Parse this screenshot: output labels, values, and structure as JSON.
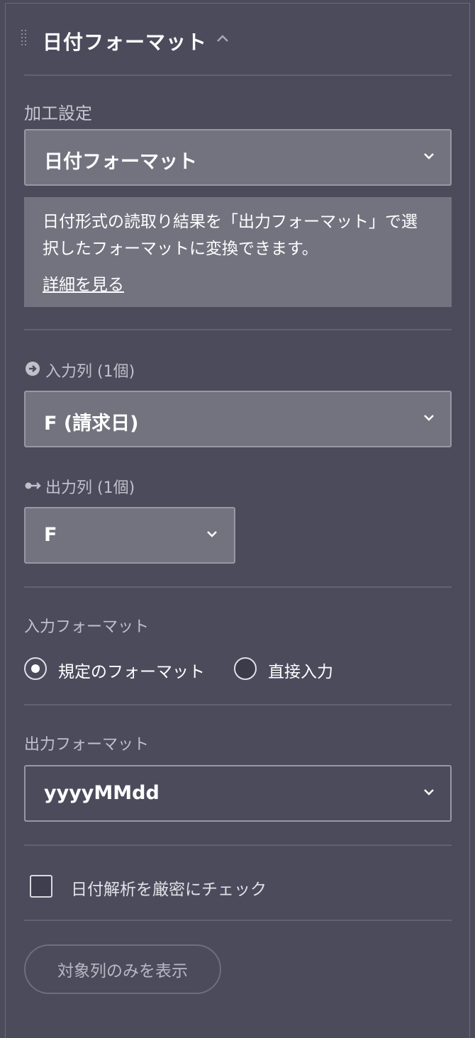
{
  "header": {
    "title": "日付フォーマット"
  },
  "processing": {
    "label": "加工設定",
    "selected": "日付フォーマット",
    "description": "日付形式の読取り結果を「出力フォーマット」で選択したフォーマットに変換できます。",
    "description_line1": "日付形式の読取り結果を「出力フォーマット」で選",
    "description_line2": "択したフォーマットに変換できます。",
    "details_link": "詳細を見る"
  },
  "input_columns": {
    "label": "入力列 (1個)",
    "selected": "F (請求日)"
  },
  "output_columns": {
    "label": "出力列 (1個)",
    "selected": "F"
  },
  "input_format": {
    "label": "入力フォーマット",
    "options": [
      {
        "label": "規定のフォーマット",
        "selected": true
      },
      {
        "label": "直接入力",
        "selected": false
      }
    ]
  },
  "output_format": {
    "label": "出力フォーマット",
    "selected": "yyyyMMdd"
  },
  "strict_check": {
    "label": "日付解析を厳密にチェック",
    "checked": false
  },
  "show_target_button": "対象列のみを表示",
  "icons": {
    "drag_handle": "drag-handle-icon",
    "collapse": "chevron-up-icon",
    "dropdown": "chevron-down-icon",
    "input": "arrow-right-circle-icon",
    "output": "key-arrow-icon"
  },
  "colors": {
    "background": "#4b4b5c",
    "select_bg": "#737380",
    "text": "#ffffff",
    "muted_text": "#c0c0ca"
  }
}
